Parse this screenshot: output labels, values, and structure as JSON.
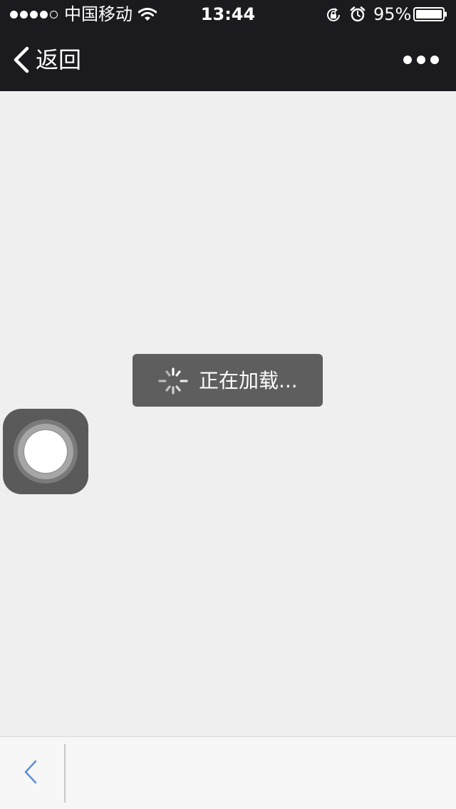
{
  "status_bar": {
    "carrier": "中国移动",
    "time": "13:44",
    "battery_percent": "95%",
    "signal_bars_filled": 4,
    "signal_bars_total": 5,
    "battery_level": 0.95,
    "icons": [
      "signal-dots-icon",
      "wifi-icon",
      "rotation-lock-icon",
      "alarm-icon",
      "battery-icon"
    ]
  },
  "nav": {
    "back_label": "返回",
    "more_icon": "more-dots-icon"
  },
  "loading": {
    "text": "正在加载...",
    "icon": "spinner-icon"
  },
  "toolbar": {
    "back_icon": "chevron-left-icon"
  },
  "colors": {
    "bar_background": "#1b1b1f",
    "content_background": "#efefef",
    "toast_background": "#5e5e5e",
    "toolbar_background": "#f7f7f7",
    "toolbar_icon": "#5b8ed6"
  }
}
